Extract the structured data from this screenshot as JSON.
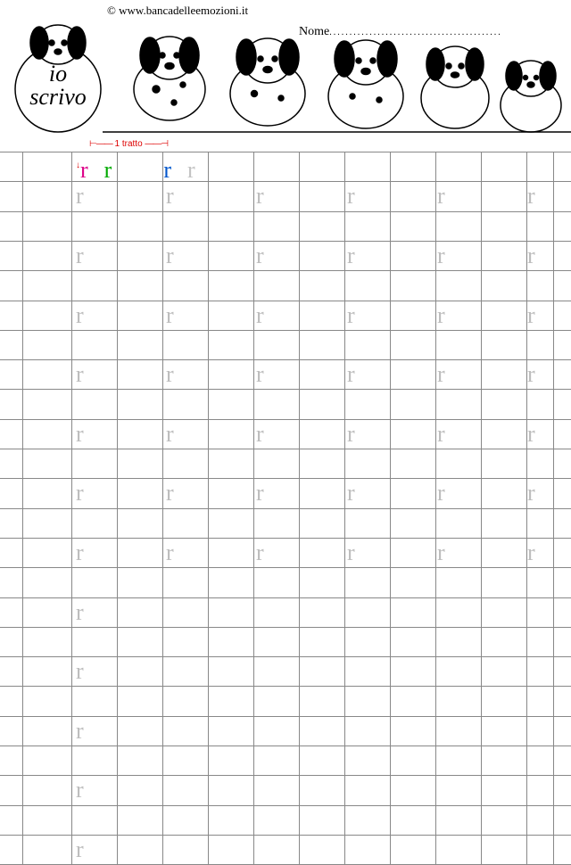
{
  "copyright": "© www.bancadelleemozioni.it",
  "name_label": "Nome",
  "name_dots": "...........................................",
  "io_scrivo_line1": "io",
  "io_scrivo_line2": "scrivo",
  "tratto_label": "1 tratto",
  "letter": "r",
  "grid": {
    "row_height": 33.3,
    "rows": 24,
    "col_xs": [
      25,
      80,
      131,
      182,
      233,
      284,
      335,
      386,
      437,
      488,
      539,
      590,
      620
    ],
    "letter_cols": [
      85,
      186,
      287,
      389,
      490,
      591
    ],
    "full_rows": [
      1,
      3,
      5,
      7,
      9,
      11,
      13
    ],
    "single_rows": [
      15,
      17,
      19,
      21,
      23
    ]
  }
}
